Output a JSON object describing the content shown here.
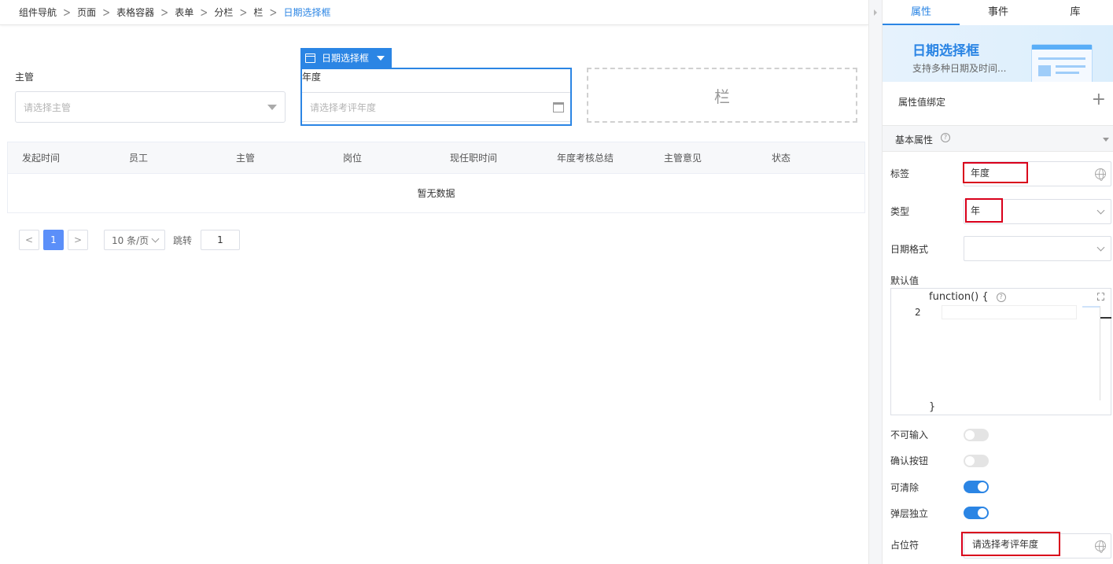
{
  "breadcrumb": {
    "items": [
      "组件导航",
      "页面",
      "表格容器",
      "表单",
      "分栏",
      "栏",
      "日期选择框"
    ]
  },
  "form": {
    "supervisor_label": "主管",
    "supervisor_placeholder": "请选择主管",
    "component_tag": "日期选择框",
    "year_label": "年度",
    "year_placeholder": "请选择考评年度",
    "column_placeholder": "栏"
  },
  "table": {
    "columns": [
      "发起时间",
      "员工",
      "主管",
      "岗位",
      "现任职时间",
      "年度考核总结",
      "主管意见",
      "状态"
    ],
    "empty_text": "暂无数据"
  },
  "pagination": {
    "prev": "<",
    "current_page": "1",
    "next": ">",
    "page_size": "10 条/页",
    "jump_label": "跳转",
    "jump_value": "1"
  },
  "panel": {
    "tabs": [
      "属性",
      "事件",
      "库"
    ],
    "active_tab": "属性",
    "banner_title": "日期选择框",
    "banner_subtitle": "支持多种日期及时间...",
    "binding_label": "属性值绑定",
    "binding_add": "+",
    "section_title": "基本属性",
    "label_field": {
      "label": "标签",
      "value": "年度"
    },
    "type_field": {
      "label": "类型",
      "value": "年"
    },
    "format_field": {
      "label": "日期格式",
      "value": ""
    },
    "default_label": "默认值",
    "code": {
      "header": "function() {",
      "line_number": "2",
      "footer": "}"
    },
    "switches": [
      {
        "label": "不可输入",
        "on": false
      },
      {
        "label": "确认按钮",
        "on": false
      },
      {
        "label": "可清除",
        "on": true
      },
      {
        "label": "弹层独立",
        "on": true
      }
    ],
    "placeholder_field": {
      "label": "占位符",
      "value": "请选择考评年度"
    }
  },
  "colors": {
    "accent": "#2b85e4",
    "highlight": "#d9001b",
    "toggle_on": "#2b85e4",
    "toggle_off": "#e4e4e4"
  }
}
